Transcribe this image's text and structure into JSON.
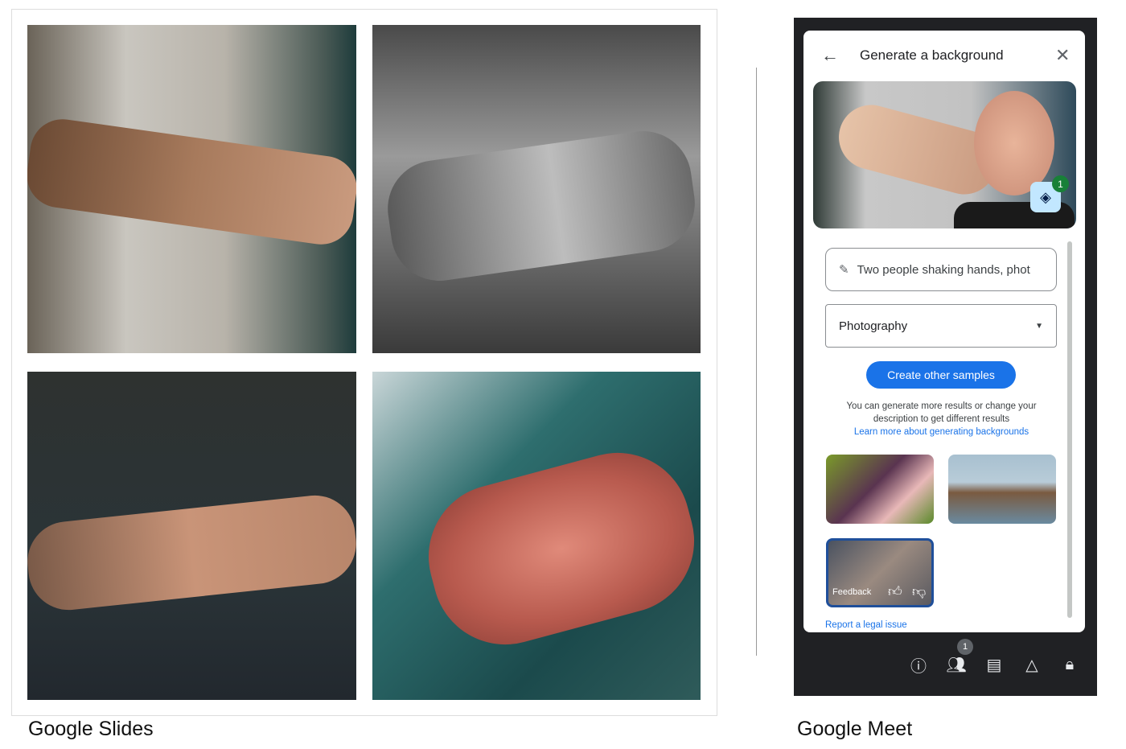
{
  "slides": {
    "caption": "Google Slides"
  },
  "meet": {
    "caption": "Google Meet",
    "panel": {
      "title": "Generate a background",
      "back_icon": "arrow-left-icon",
      "close_icon": "close-icon",
      "effects_badge": "1",
      "prompt_value": "Two people shaking hands, phot",
      "style_value": "Photography",
      "create_button": "Create other samples",
      "help_line1": "You can generate more results or change your",
      "help_line2": "description to get different results",
      "learn_more": "Learn more about generating backgrounds",
      "feedback_label": "Feedback",
      "report_link": "Report a legal issue"
    },
    "toolbar": {
      "people_badge": "1",
      "icons": [
        "info-icon",
        "people-icon",
        "chat-icon",
        "activities-icon",
        "host-controls-icon"
      ]
    },
    "colors": {
      "accent": "#1a73e8",
      "dark": "#202124",
      "badge_green": "#188038"
    }
  }
}
